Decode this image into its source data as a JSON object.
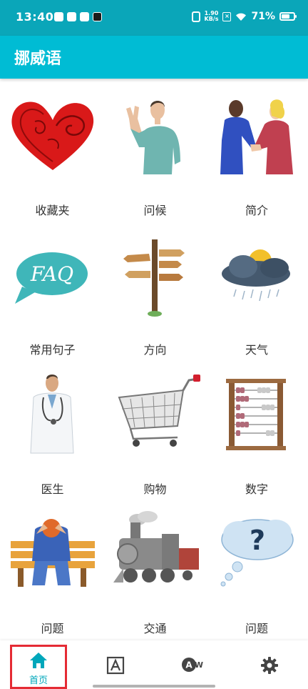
{
  "status_bar": {
    "time": "13:40",
    "net_speed_value": "1.90",
    "net_speed_unit": "KB/s",
    "battery_percent": "71%",
    "battery_level": 0.71
  },
  "app_bar": {
    "title": "挪威语"
  },
  "categories": [
    {
      "label": "收藏夹",
      "icon": "heart-icon"
    },
    {
      "label": "问候",
      "icon": "waving-man-icon"
    },
    {
      "label": "简介",
      "icon": "handshake-icon"
    },
    {
      "label": "常用句子",
      "icon": "faq-bubble-icon"
    },
    {
      "label": "方向",
      "icon": "signpost-icon"
    },
    {
      "label": "天气",
      "icon": "storm-cloud-icon"
    },
    {
      "label": "医生",
      "icon": "doctor-icon"
    },
    {
      "label": "购物",
      "icon": "shopping-cart-icon"
    },
    {
      "label": "数字",
      "icon": "abacus-icon"
    },
    {
      "label": "问题",
      "icon": "worried-person-icon"
    },
    {
      "label": "交通",
      "icon": "train-icon"
    },
    {
      "label": "问题",
      "icon": "question-cloud-icon"
    }
  ],
  "bottom_nav": {
    "home_label": "首页",
    "icons": [
      "home-icon",
      "letter-a-icon",
      "translate-aw-icon",
      "settings-icon"
    ]
  },
  "colors": {
    "status_bar": "#0aa6b9",
    "app_bar": "#00bcd4",
    "nav_active": "#00a7bb",
    "highlight_border": "#e52b34"
  }
}
